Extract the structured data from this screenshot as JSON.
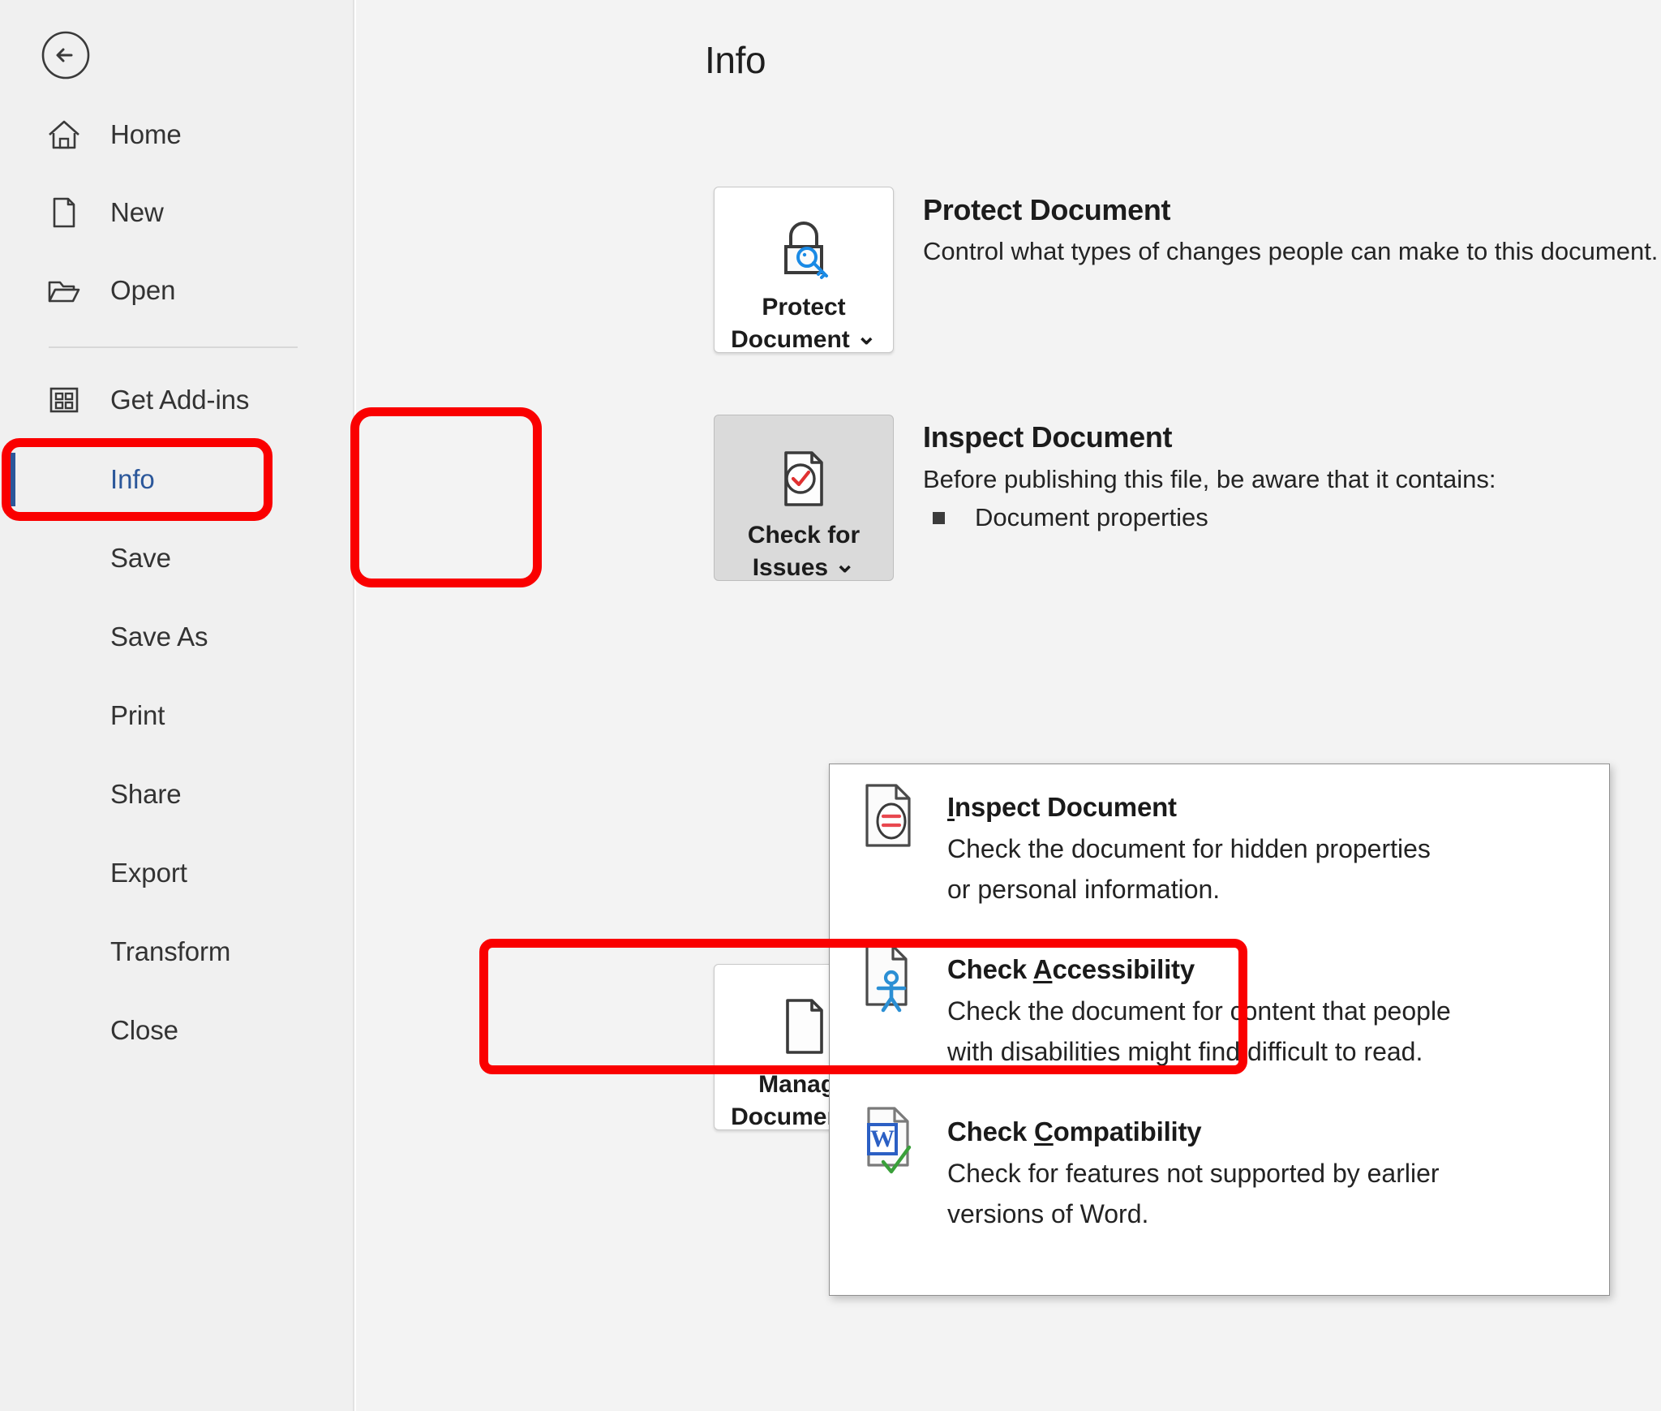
{
  "sidebar": {
    "back_icon": "back-arrow-icon",
    "items": [
      {
        "label": "Home",
        "icon": "home-icon",
        "active": false
      },
      {
        "label": "New",
        "icon": "page-icon",
        "active": false
      },
      {
        "label": "Open",
        "icon": "folder-icon",
        "active": false
      },
      {
        "label": "Get Add-ins",
        "icon": "grid-icon",
        "active": false
      },
      {
        "label": "Info",
        "icon": "",
        "active": true
      },
      {
        "label": "Save",
        "icon": "",
        "active": false
      },
      {
        "label": "Save As",
        "icon": "",
        "active": false
      },
      {
        "label": "Print",
        "icon": "",
        "active": false
      },
      {
        "label": "Share",
        "icon": "",
        "active": false
      },
      {
        "label": "Export",
        "icon": "",
        "active": false
      },
      {
        "label": "Transform",
        "icon": "",
        "active": false
      },
      {
        "label": "Close",
        "icon": "",
        "active": false
      }
    ]
  },
  "main": {
    "page_title": "Info",
    "tiles": {
      "protect": {
        "label": "Protect\nDocument",
        "icon": "lock-key-icon",
        "chevron": "⌄"
      },
      "check": {
        "label": "Check for\nIssues",
        "icon": "document-check-icon",
        "chevron": "⌄"
      },
      "manage": {
        "label": "Manage\nDocument",
        "icon": "manage-document-icon",
        "chevron": "⌄"
      }
    },
    "sections": [
      {
        "title": "Protect Document",
        "desc": "Control what types of changes people can make to this document.",
        "bullets": []
      },
      {
        "title": "Inspect Document",
        "desc": "Before publishing this file, be aware that it contains:",
        "bullets": [
          "Document properties"
        ]
      }
    ]
  },
  "dropdown": {
    "items": [
      {
        "title_pre": "",
        "title_accel": "I",
        "title_post": "nspect Document",
        "desc": "Check the document for hidden properties\nor personal information.",
        "icon": "inspect-document-icon"
      },
      {
        "title_pre": "Check ",
        "title_accel": "A",
        "title_post": "ccessibility",
        "desc": "Check the document for content that people\nwith disabilities might find difficult to read.",
        "icon": "accessibility-icon"
      },
      {
        "title_pre": "Check ",
        "title_accel": "C",
        "title_post": "ompatibility",
        "desc": "Check for features not supported by earlier\nversions of Word.",
        "icon": "word-compatibility-icon"
      }
    ]
  },
  "annotations": {
    "color": "#fa0000",
    "boxes": [
      "info-nav-item",
      "check-for-issues-tile",
      "check-accessibility-menu-item"
    ]
  },
  "colors": {
    "accent_blue": "#2b579a",
    "sidebar_bg": "#f0f0f0",
    "main_bg": "#f3f3f3",
    "highlight_red": "#fa0000"
  }
}
